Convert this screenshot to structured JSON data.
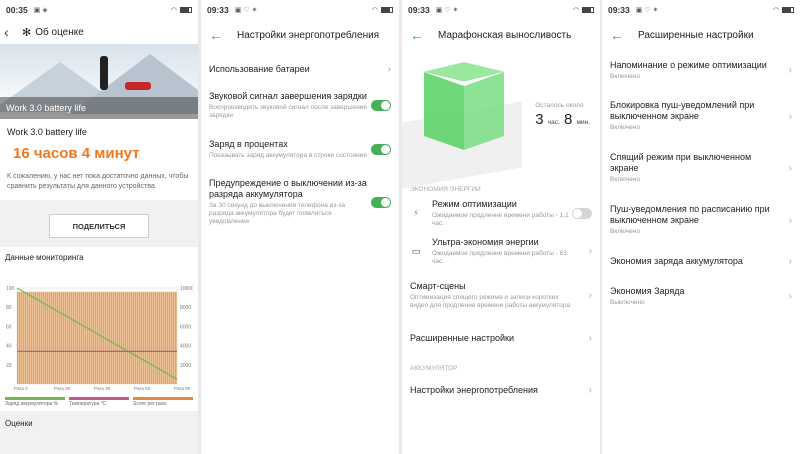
{
  "colors": {
    "accent": "#44b158",
    "orange": "#f2761a"
  },
  "p1": {
    "time": "00:35",
    "header_title": "Об оценке",
    "hero_caption": "Work 3.0 battery life",
    "card_title": "Work 3.0 battery life",
    "result": "16 часов 4 минут",
    "note": "К сожалению, у нас нет пока достаточно данных, чтобы сравнить результаты для данного устройства.",
    "share_label": "ПОДЕЛИТЬСЯ",
    "monitor_title": "Данные мониторинга",
    "left_ticks": [
      "100",
      "80",
      "60",
      "40",
      "20"
    ],
    "right_ticks": [
      "10000",
      "8000",
      "6000",
      "4000",
      "2000"
    ],
    "x_ticks": [
      "Pass 0",
      "Pass 20",
      "Pass 40",
      "Pass 60",
      "Pass 80"
    ],
    "legend": [
      "Заряд аккумулятора %",
      "Температура °C",
      "Score per pass"
    ],
    "scores_title": "Оценки"
  },
  "chart_data": {
    "type": "bar",
    "title": "",
    "xlabel": "",
    "ylabel": "",
    "x_ticks": [
      "Pass 0",
      "Pass 20",
      "Pass 40",
      "Pass 60",
      "Pass 80"
    ],
    "ylim_left": [
      0,
      100
    ],
    "ylim_right": [
      0,
      10000
    ],
    "series": [
      {
        "name": "Score per pass",
        "axis": "right",
        "count": 80,
        "value": 9600
      },
      {
        "name": "Заряд аккумулятора %",
        "axis": "left",
        "x": [
          0,
          80
        ],
        "values": [
          100,
          5
        ]
      },
      {
        "name": "Температура °C",
        "axis": "left",
        "x": [
          0,
          80
        ],
        "values": [
          34,
          34
        ]
      }
    ]
  },
  "p2": {
    "time": "09:33",
    "title": "Настройки энергопотребления",
    "items": [
      {
        "title": "Использование батареи",
        "sub": ""
      },
      {
        "title": "Звуковой сигнал завершения зарядки",
        "sub": "Воспроизводить звуковой сигнал после завершения зарядки"
      },
      {
        "title": "Заряд в процентах",
        "sub": "Показывать заряд аккумулятора в строке состояния"
      },
      {
        "title": "Предупреждение о выключении из-за разряда аккумулятора",
        "sub": "За 30 секунд до выключения телефона из-за разряда аккумулятора будет появляться уведомление"
      }
    ]
  },
  "p3": {
    "time": "09:33",
    "title": "Марафонская выносливость",
    "remain_label": "Осталось около",
    "hours": "3",
    "hours_unit": "час.",
    "minutes": "8",
    "minutes_unit": "мин.",
    "group1": "ЭКОНОМИЯ ЭНЕРГИИ",
    "opt_title": "Режим оптимизации",
    "opt_sub": "Ожидаемое продление времени работы - 1,1 час.",
    "ultra_title": "Ультра-экономия энергии",
    "ultra_sub": "Ожидаемое продление времени работы - 63 час.",
    "smart_title": "Смарт-сцены",
    "smart_sub": "Оптимизация спящего режима и записи коротких видео для продления времени работы аккумулятора",
    "advanced": "Расширенные настройки",
    "group2": "АККУМУЛЯТОР",
    "power": "Настройки энергопотребления"
  },
  "p4": {
    "time": "09:33",
    "title": "Расширенные настройки",
    "items": [
      {
        "title": "Напоминание о режиме оптимизации",
        "sub": "Включено"
      },
      {
        "title": "Блокировка пуш-уведомлений при выключенном экране",
        "sub": "Включено"
      },
      {
        "title": "Спящий режим при выключенном экране",
        "sub": "Включено"
      },
      {
        "title": "Пуш-уведомления по расписанию при выключенном экране",
        "sub": "Включено"
      },
      {
        "title": "Экономия заряда аккумулятора",
        "sub": ""
      },
      {
        "title": "Экономия Заряда",
        "sub": "Выключено"
      }
    ]
  }
}
